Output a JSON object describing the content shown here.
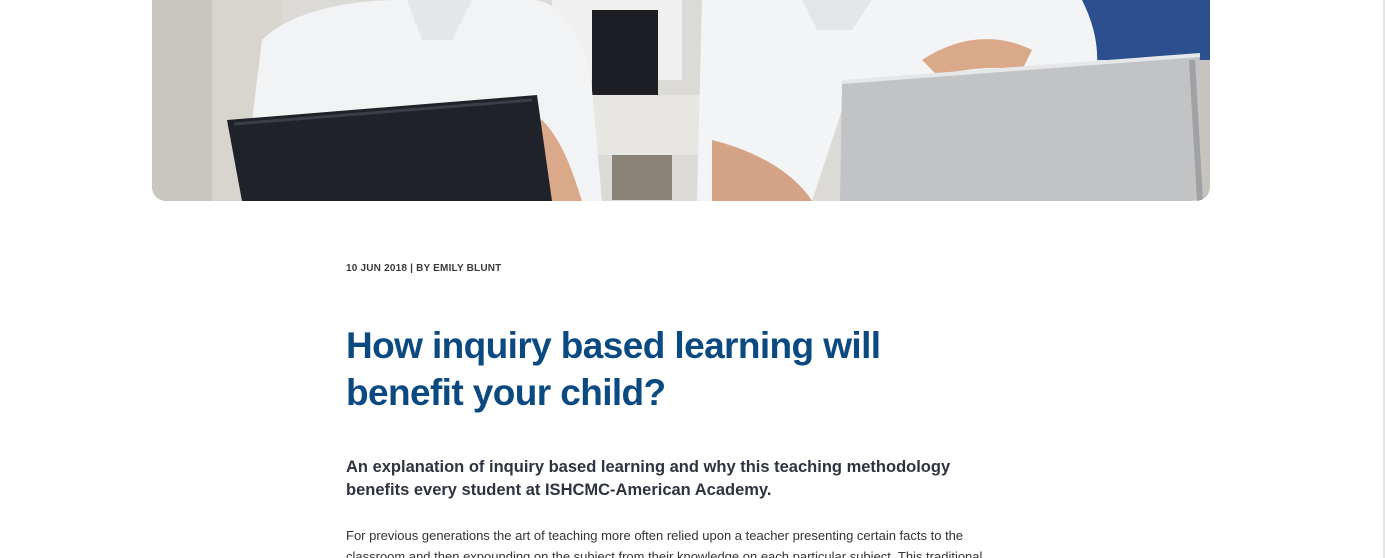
{
  "hero": {
    "image_description_icon": "classroom-photo"
  },
  "article": {
    "meta": "10 JUN 2018 | BY EMILY BLUNT",
    "title": "How inquiry based learning will benefit your child?",
    "lead": "An explanation of inquiry based learning and why this teaching methodology benefits every student at ISHCMC-American Academy.",
    "body": "For previous generations the art of teaching more often relied upon a teacher presenting certain facts to the classroom and then expounding on the subject from their knowledge on each particular subject. This traditional"
  },
  "colors": {
    "title": "#0a4a80",
    "lead": "#2f3340",
    "meta": "#3a3a3a",
    "body": "#333333"
  }
}
